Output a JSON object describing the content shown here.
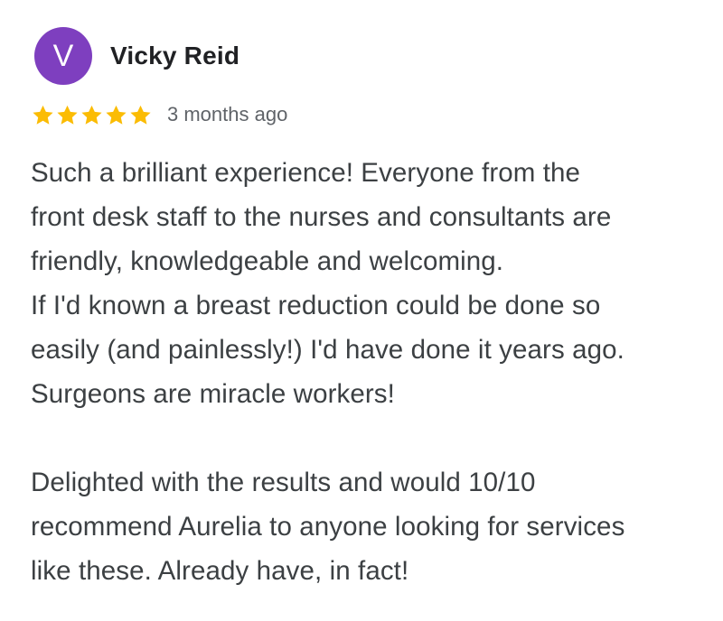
{
  "review": {
    "author": {
      "initial": "V",
      "name": "Vicky Reid",
      "avatar_color": "#7E3FBF"
    },
    "rating": {
      "stars": 5,
      "max": 5,
      "star_color": "#FBBC04",
      "icon": "star-icon"
    },
    "date": "3 months ago",
    "text": "Such a brilliant experience! Everyone from the\nfront desk staff to the nurses and consultants are\nfriendly, knowledgeable and welcoming.\nIf I'd known a breast reduction could be done so\neasily (and painlessly!) I'd have done it years ago.\nSurgeons are miracle workers!\n\nDelighted with the results and would 10/10\nrecommend Aurelia to anyone looking for services\nlike these. Already have, in fact!"
  }
}
